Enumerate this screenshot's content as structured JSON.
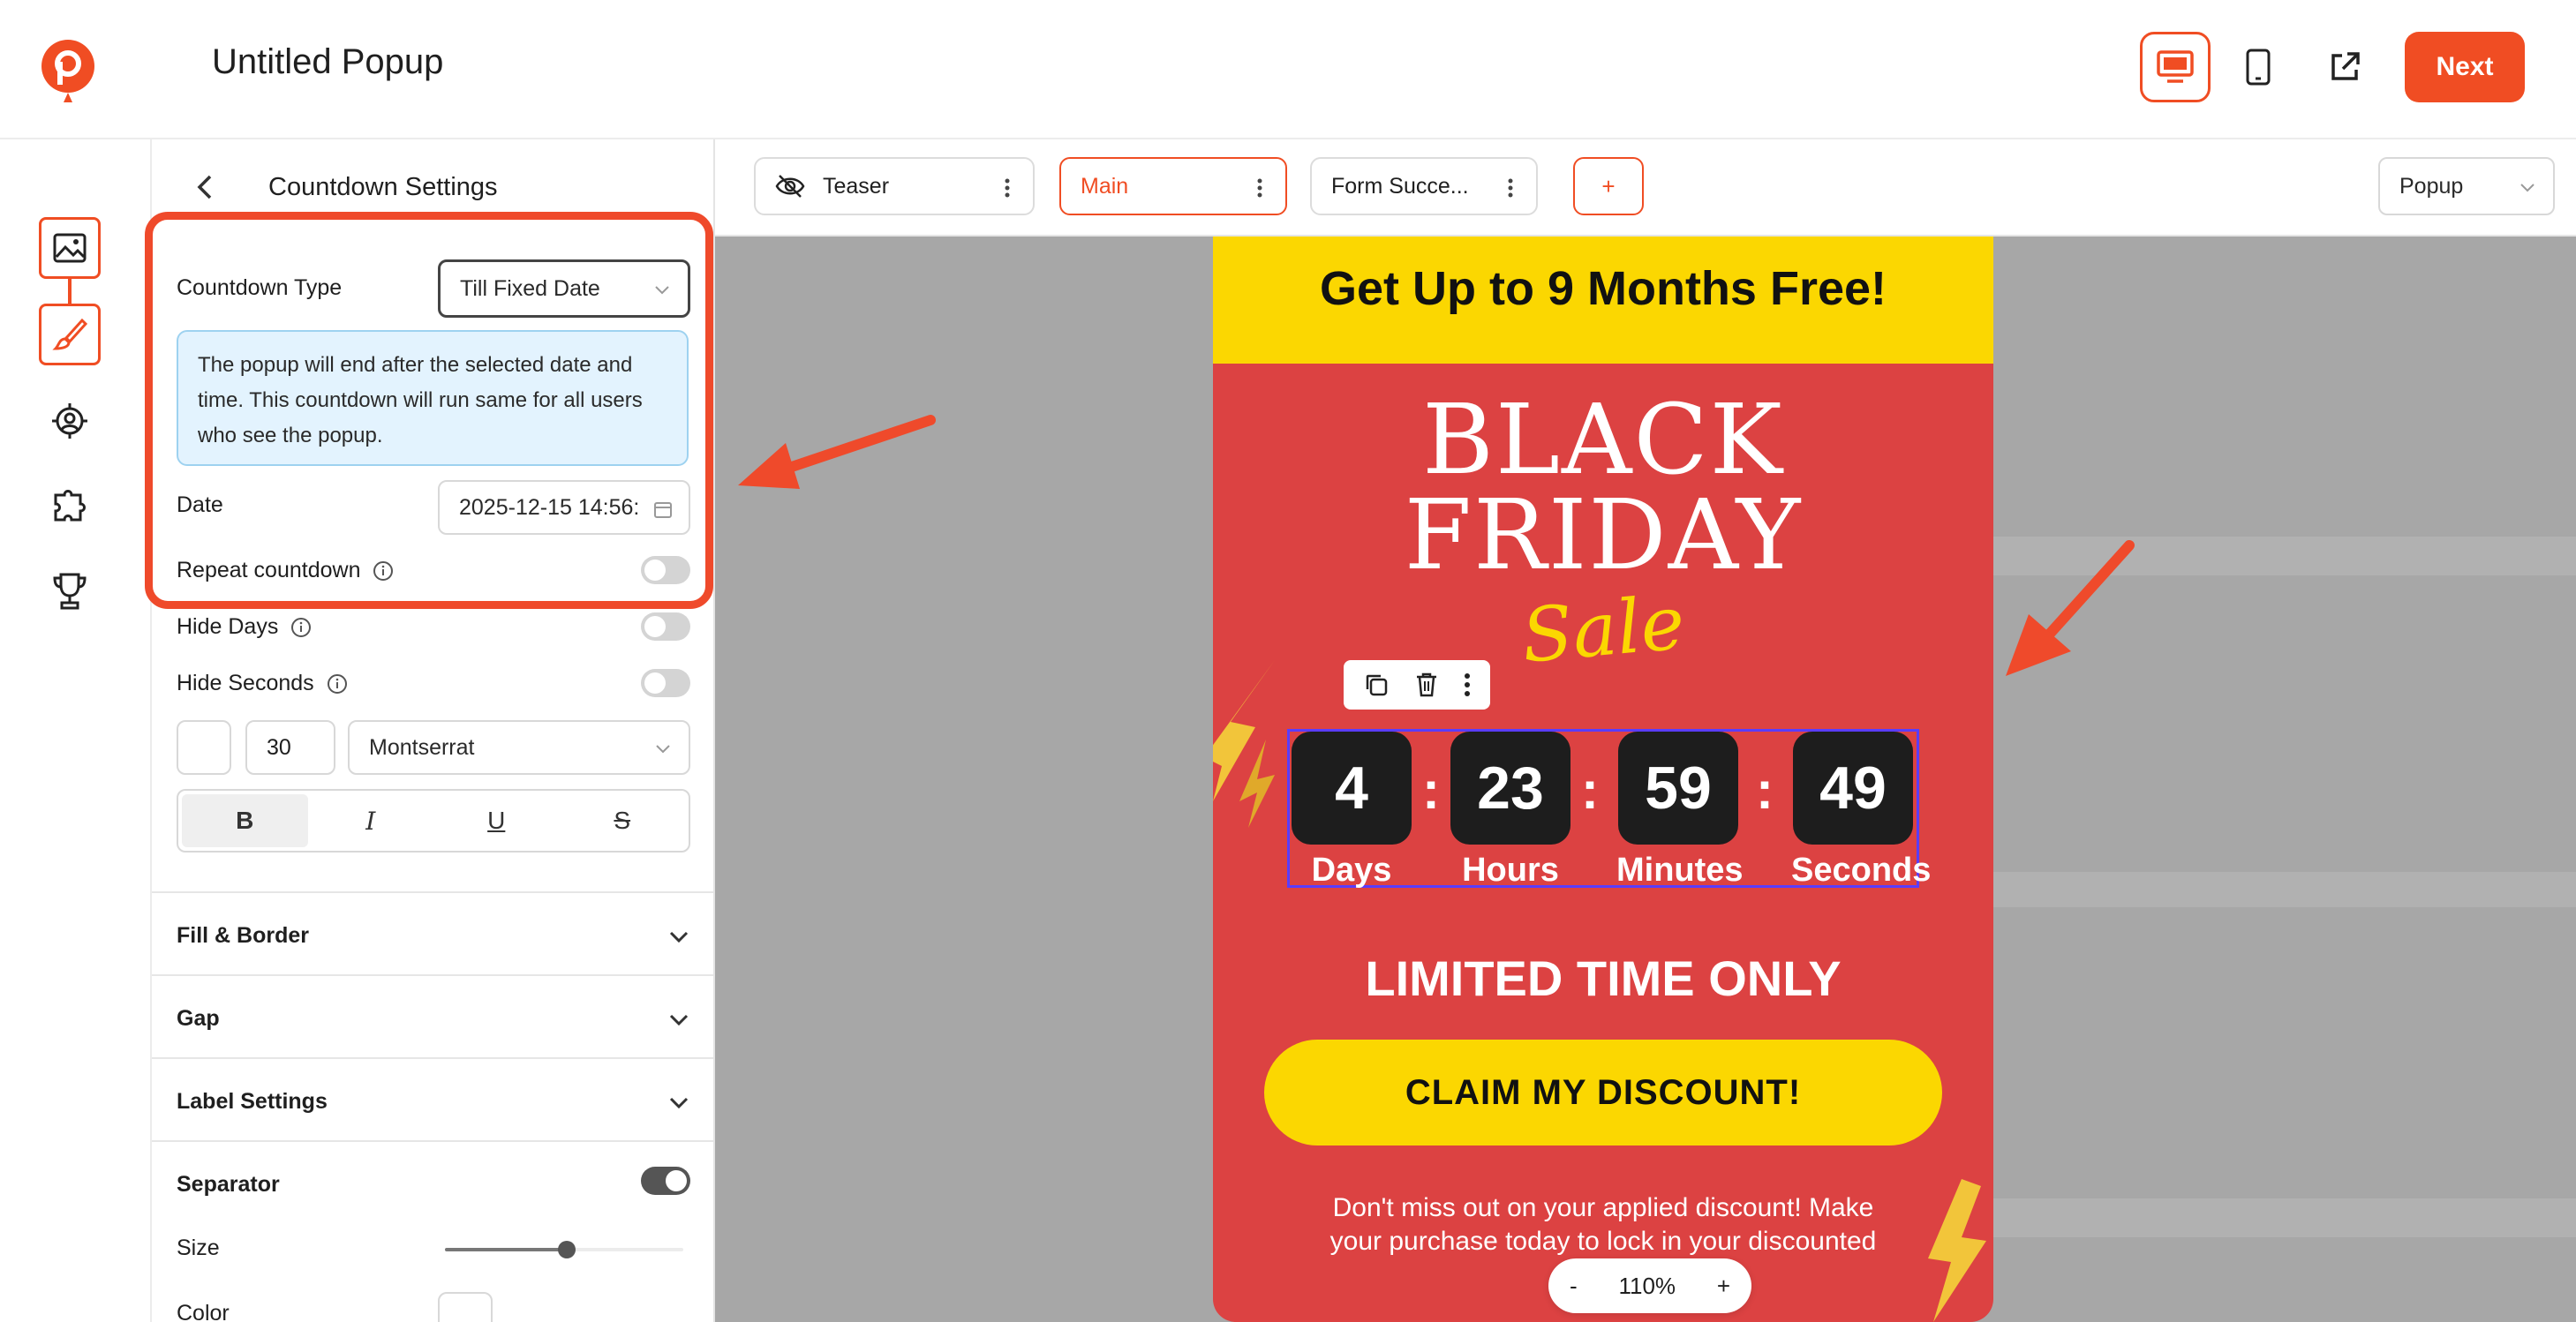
{
  "app": {
    "title": "Untitled Popup",
    "next_label": "Next",
    "accent": "#f04d23"
  },
  "top_icons": [
    "desktop-icon",
    "mobile-icon",
    "external-link-icon"
  ],
  "rail": [
    "image-icon",
    "brush-icon",
    "target-icon",
    "puzzle-icon",
    "trophy-icon"
  ],
  "panel": {
    "title": "Countdown Settings",
    "countdown_type_label": "Countdown Type",
    "countdown_type_value": "Till Fixed Date",
    "note": "The popup will end after the selected date and time. This countdown will run same for all users who see the popup.",
    "date_label": "Date",
    "date_value": "2025-12-15 14:56:",
    "repeat_label": "Repeat countdown",
    "hide_days_label": "Hide Days",
    "hide_seconds_label": "Hide Seconds",
    "font_size": "30",
    "font_family": "Montserrat",
    "format": {
      "bold": "B",
      "italic": "I",
      "underline": "U",
      "strike": "S"
    },
    "sections": {
      "fill_border": "Fill & Border",
      "gap": "Gap",
      "label_settings": "Label Settings",
      "separator": "Separator"
    },
    "size_label": "Size",
    "color_label": "Color",
    "toggles": {
      "repeat": false,
      "hide_days": false,
      "hide_seconds": false,
      "separator": true
    },
    "separator_size_fraction": 0.56
  },
  "tabs": {
    "teaser": "Teaser",
    "main": "Main",
    "form_success": "Form Succe...",
    "add": "+",
    "popup_type": "Popup"
  },
  "popup": {
    "headline": "Get Up to 9 Months Free!",
    "black": "BLACK",
    "friday": "FRIDAY",
    "sale": "Sale",
    "countdown": [
      {
        "value": "4",
        "label": "Days"
      },
      {
        "value": "23",
        "label": "Hours"
      },
      {
        "value": "59",
        "label": "Minutes"
      },
      {
        "value": "49",
        "label": "Seconds"
      }
    ],
    "separator": ":",
    "limited": "LIMITED TIME ONLY",
    "cta": "CLAIM MY DISCOUNT!",
    "fine_print": "Don't miss out on your applied discount! Make your purchase today to lock in your discounted offer be",
    "colors": {
      "background": "#dc4242",
      "banner": "#fbd701",
      "digit_box": "#1d1d1d"
    }
  },
  "zoom": {
    "minus": "-",
    "value": "110%",
    "plus": "+"
  }
}
